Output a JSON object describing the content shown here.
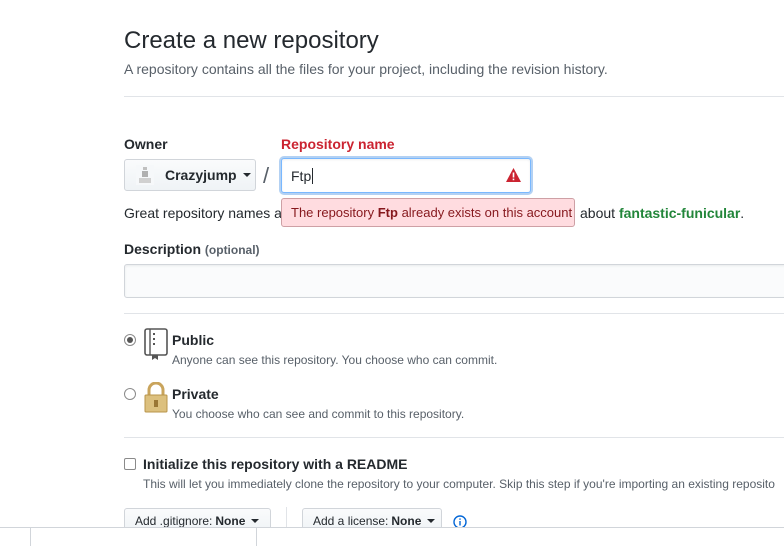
{
  "page": {
    "title": "Create a new repository",
    "subtitle": "A repository contains all the files for your project, including the revision history."
  },
  "owner": {
    "label": "Owner",
    "value": "Crazyjump"
  },
  "separator": "/",
  "repo_name": {
    "label": "Repository name",
    "value": "Ftp"
  },
  "hint": {
    "prefix": "Great repository names ar",
    "suffix": "about",
    "suggestion": "fantastic-funicular",
    "period": "."
  },
  "error": {
    "before": "The repository",
    "name": "Ftp",
    "after": "already exists on this account"
  },
  "description": {
    "label": "Description",
    "optional": "(optional)",
    "value": ""
  },
  "visibility": {
    "public": {
      "title": "Public",
      "desc": "Anyone can see this repository. You choose who can commit.",
      "selected": true
    },
    "private": {
      "title": "Private",
      "desc": "You choose who can see and commit to this repository.",
      "selected": false
    }
  },
  "readme": {
    "title": "Initialize this repository with a README",
    "desc": "This will let you immediately clone the repository to your computer. Skip this step if you're importing an existing reposito",
    "checked": false
  },
  "gitignore": {
    "prefix": "Add .gitignore:",
    "value": "None"
  },
  "license": {
    "prefix": "Add a license:",
    "value": "None"
  },
  "colors": {
    "error_text": "#cb2431",
    "error_bg": "#ffdce0",
    "suggestion": "#22863a",
    "focus_border": "#79b8ff"
  },
  "icons": {
    "owner_avatar": "user-avatar-icon",
    "warning": "warning-triangle-icon",
    "public": "repo-book-icon",
    "private": "lock-icon",
    "info": "info-icon"
  }
}
